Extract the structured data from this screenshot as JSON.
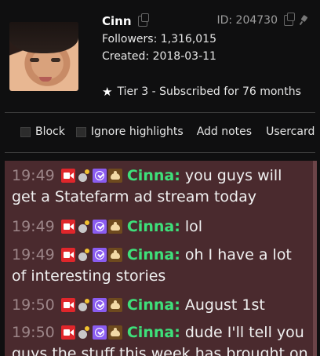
{
  "user": {
    "name": "Cinn",
    "id_text": "ID: 204730",
    "followers_text": "Followers: 1,316,015",
    "created_text": "Created: 2018-03-11",
    "tier_text": "Tier 3 - Subscribed for 76 months"
  },
  "actions": {
    "block": "Block",
    "ignore_highlights": "Ignore highlights",
    "add_notes": "Add notes",
    "usercard": "Usercard"
  },
  "badges": [
    "video-badge-icon",
    "bomb-badge-icon",
    "verified-badge-icon",
    "subscriber-badge-icon"
  ],
  "messages": [
    {
      "time": "19:49",
      "user": "Cinna:",
      "text": "you guys will get a Statefarm ad stream today"
    },
    {
      "time": "19:49",
      "user": "Cinna:",
      "text": "lol"
    },
    {
      "time": "19:49",
      "user": "Cinna:",
      "text": "oh I have a lot of interesting stories"
    },
    {
      "time": "19:50",
      "user": "Cinna:",
      "text": "August 1st"
    },
    {
      "time": "19:50",
      "user": "Cinna:",
      "text": "dude I'll tell you guys the stuff this week has brought on"
    }
  ],
  "colors": {
    "chat_bg": "#4a2a2e",
    "username": "#3ee07a",
    "timestamp": "#9c8588",
    "page_bg": "#0f0f10"
  }
}
